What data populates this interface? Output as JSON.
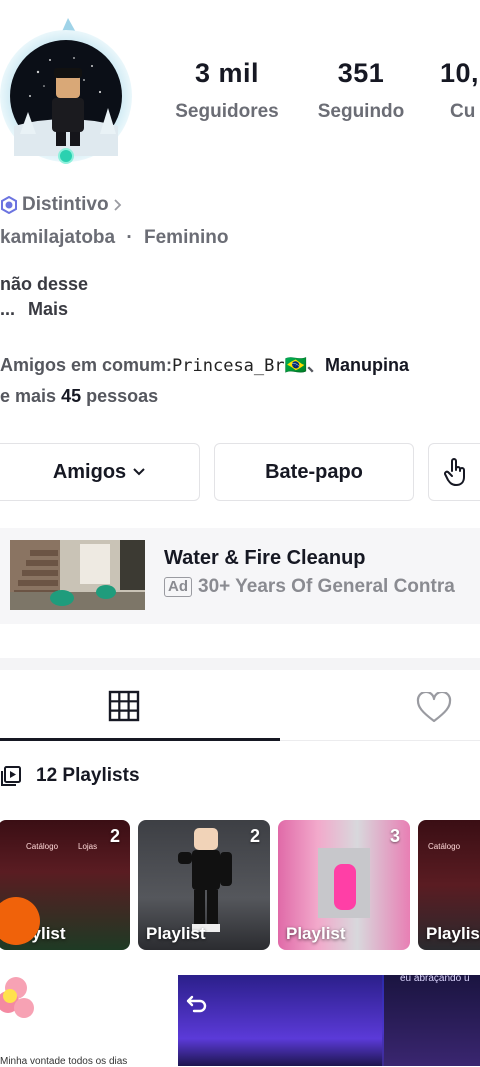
{
  "profile": {
    "stats": [
      {
        "value": "3 mil",
        "label": "Seguidores"
      },
      {
        "value": "351",
        "label": "Seguindo"
      },
      {
        "value": "10,",
        "label": "Cu"
      }
    ],
    "badge_label": "Distintivo",
    "username": "kamilajatoba",
    "separator": "·",
    "gender": "Feminino",
    "bio_line1": "não desse",
    "bio_ellipsis": "...",
    "bio_more": "Mais",
    "mutual_prefix": "Amigos em comum:",
    "mutual_friend1": "Princesa_Br",
    "mutual_flag": "🇧🇷",
    "mutual_sep": "、",
    "mutual_friend2": "Manupina",
    "mutual_suffix_pre": "e mais",
    "mutual_count": "45",
    "mutual_suffix_post": "pessoas"
  },
  "actions": {
    "friends_label": "Amigos",
    "chat_label": "Bate-papo"
  },
  "ad": {
    "title": "Water & Fire Cleanup",
    "tag": "Ad",
    "subtitle": "30+ Years Of General Contra"
  },
  "playlists": {
    "header": "12 Playlists",
    "items": [
      {
        "name": "Playlist",
        "count": "2",
        "overlay_text_1": "Catálogo",
        "overlay_text_2": "Lojas"
      },
      {
        "name": "Playlist",
        "count": "2"
      },
      {
        "name": "Playlist",
        "count": "3"
      },
      {
        "name": "Playlist",
        "count": "",
        "overlay_text_1": "Catálogo"
      }
    ]
  },
  "bottom": {
    "caption_left": "Minha vontade todos os dias",
    "caption_right": "eu abraçando u"
  },
  "colors": {
    "text_primary": "#161823",
    "text_secondary": "#6b6d75",
    "ad_bg": "#f6f6f8",
    "badge_blue": "#6c74e0"
  }
}
